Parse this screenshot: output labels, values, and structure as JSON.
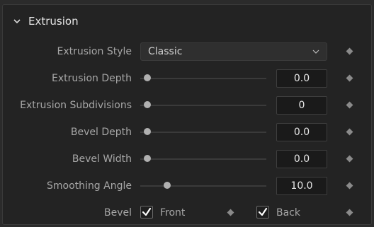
{
  "section": {
    "title": "Extrusion",
    "chevron_icon": "chevron-down-icon"
  },
  "rows": {
    "extrusion_style": {
      "label": "Extrusion Style",
      "value": "Classic"
    },
    "extrusion_depth": {
      "label": "Extrusion Depth",
      "value": "0.0",
      "slider_fraction": 0.0
    },
    "extrusion_subdivisions": {
      "label": "Extrusion Subdivisions",
      "value": "0",
      "slider_fraction": 0.0
    },
    "bevel_depth": {
      "label": "Bevel Depth",
      "value": "0.0",
      "slider_fraction": 0.0
    },
    "bevel_width": {
      "label": "Bevel Width",
      "value": "0.0",
      "slider_fraction": 0.0
    },
    "smoothing_angle": {
      "label": "Smoothing Angle",
      "value": "10.0",
      "slider_fraction": 0.18
    }
  },
  "bevel": {
    "label": "Bevel",
    "front_label": "Front",
    "back_label": "Back",
    "front_checked": true,
    "back_checked": true
  },
  "colors": {
    "background": "#232323",
    "text": "#a6a6a6",
    "value_text": "#e6e6e6"
  }
}
